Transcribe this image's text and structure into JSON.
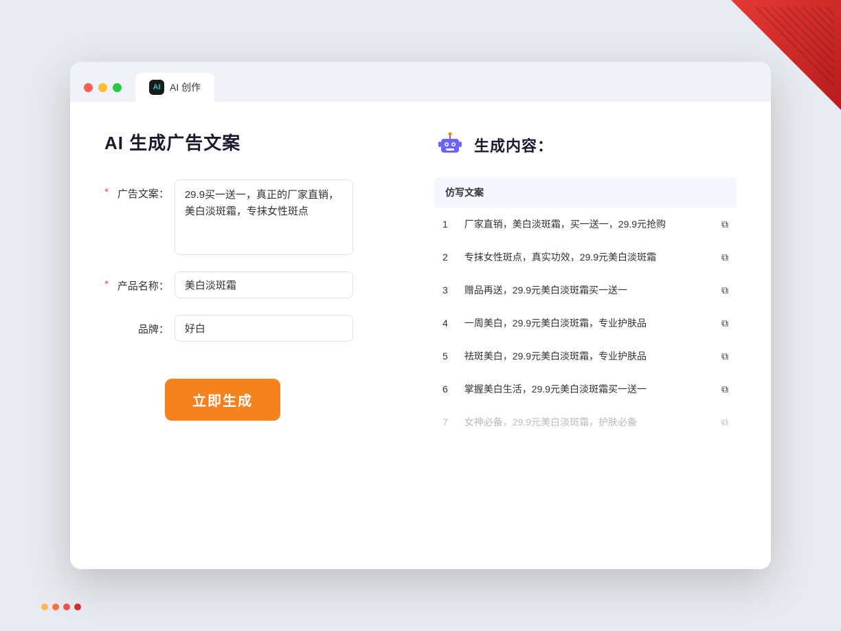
{
  "window": {
    "tab_icon_label": "AI",
    "tab_label": "AI 创作"
  },
  "left_panel": {
    "title": "AI 生成广告文案",
    "form": {
      "ad_copy_label": "广告文案：",
      "ad_copy_required": "*",
      "ad_copy_value": "29.9买一送一，真正的厂家直销，美白淡斑霜，专抹女性斑点",
      "product_name_label": "产品名称：",
      "product_name_required": "*",
      "product_name_value": "美白淡斑霜",
      "brand_label": "品牌：",
      "brand_value": "好白"
    },
    "generate_button": "立即生成"
  },
  "right_panel": {
    "title": "生成内容：",
    "table_header": "仿写文案",
    "results": [
      {
        "num": "1",
        "text": "厂家直销，美白淡斑霜，买一送一，29.9元抢购",
        "dimmed": false
      },
      {
        "num": "2",
        "text": "专抹女性斑点，真实功效，29.9元美白淡斑霜",
        "dimmed": false
      },
      {
        "num": "3",
        "text": "赠品再送，29.9元美白淡斑霜买一送一",
        "dimmed": false
      },
      {
        "num": "4",
        "text": "一周美白，29.9元美白淡斑霜，专业护肤品",
        "dimmed": false
      },
      {
        "num": "5",
        "text": "祛斑美白，29.9元美白淡斑霜，专业护肤品",
        "dimmed": false
      },
      {
        "num": "6",
        "text": "掌握美白生活，29.9元美白淡斑霜买一送一",
        "dimmed": false
      },
      {
        "num": "7",
        "text": "女神必备，29.9元美白淡斑霜，护肤必备",
        "dimmed": true
      }
    ]
  },
  "decorations": {
    "dots": [
      "#ff8a65",
      "#ef5350",
      "#e53935"
    ]
  }
}
